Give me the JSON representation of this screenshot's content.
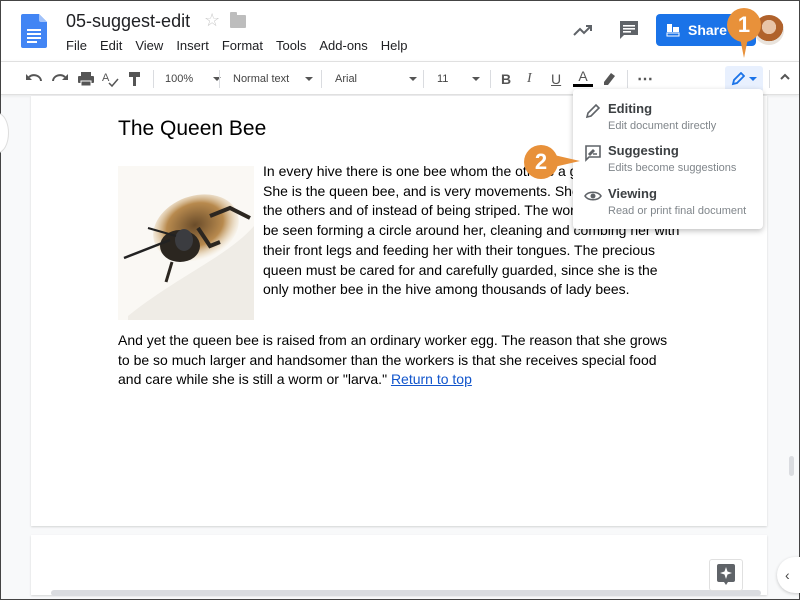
{
  "header": {
    "title": "05-suggest-edit",
    "icons": {
      "app_logo": "google-docs-icon",
      "star": "star-icon",
      "folder": "folder-icon",
      "activity": "activity-trend-icon",
      "comments": "comment-icon"
    },
    "star_glyph": "☆",
    "share_label": "Share",
    "menu": [
      "File",
      "Edit",
      "View",
      "Insert",
      "Format",
      "Tools",
      "Add-ons",
      "Help"
    ]
  },
  "toolbar": {
    "zoom": "100%",
    "style": "Normal text",
    "font": "Arial",
    "font_size": "11",
    "bold": "B",
    "italic": "I",
    "underline": "U",
    "text_color": "A",
    "text_color_value": "#000000",
    "more": "⋯",
    "mode_icon": "pencil-icon",
    "collapse_glyph": "⌃"
  },
  "mode_menu": {
    "items": [
      {
        "label": "Editing",
        "description": "Edit document directly",
        "icon": "pencil-icon"
      },
      {
        "label": "Suggesting",
        "description": "Edits become suggestions",
        "icon": "suggest-icon"
      },
      {
        "label": "Viewing",
        "description": "Read or print final document",
        "icon": "eye-icon"
      }
    ]
  },
  "callouts": {
    "one": "1",
    "two": "2",
    "color": "#e8913a"
  },
  "document": {
    "heading": "The Queen Bee",
    "paragraph1": "In every hive there is one bee whom the others a great respect. She is the queen bee, and is very movements. She is larger than the others and of instead of being striped. The workers may often be seen forming a circle around her, cleaning and combing her with their front legs and feeding her with their tongues. The precious queen must be cared for and carefully guarded, since she is the only mother bee in the hive among thousands of lady bees.",
    "paragraph2": "And yet the queen bee is raised from an ordinary worker egg. The reason that she grows to be so much larger and handsomer than the workers is that she receives special food and care while she is still a worm or \"larva.\" ",
    "link": "Return to top",
    "image": "queen-bee-photo"
  },
  "side_panel_glyph": "‹",
  "colors": {
    "accent": "#1a73e8",
    "mode_bg": "#e8f0fe",
    "link": "#1155cc"
  }
}
